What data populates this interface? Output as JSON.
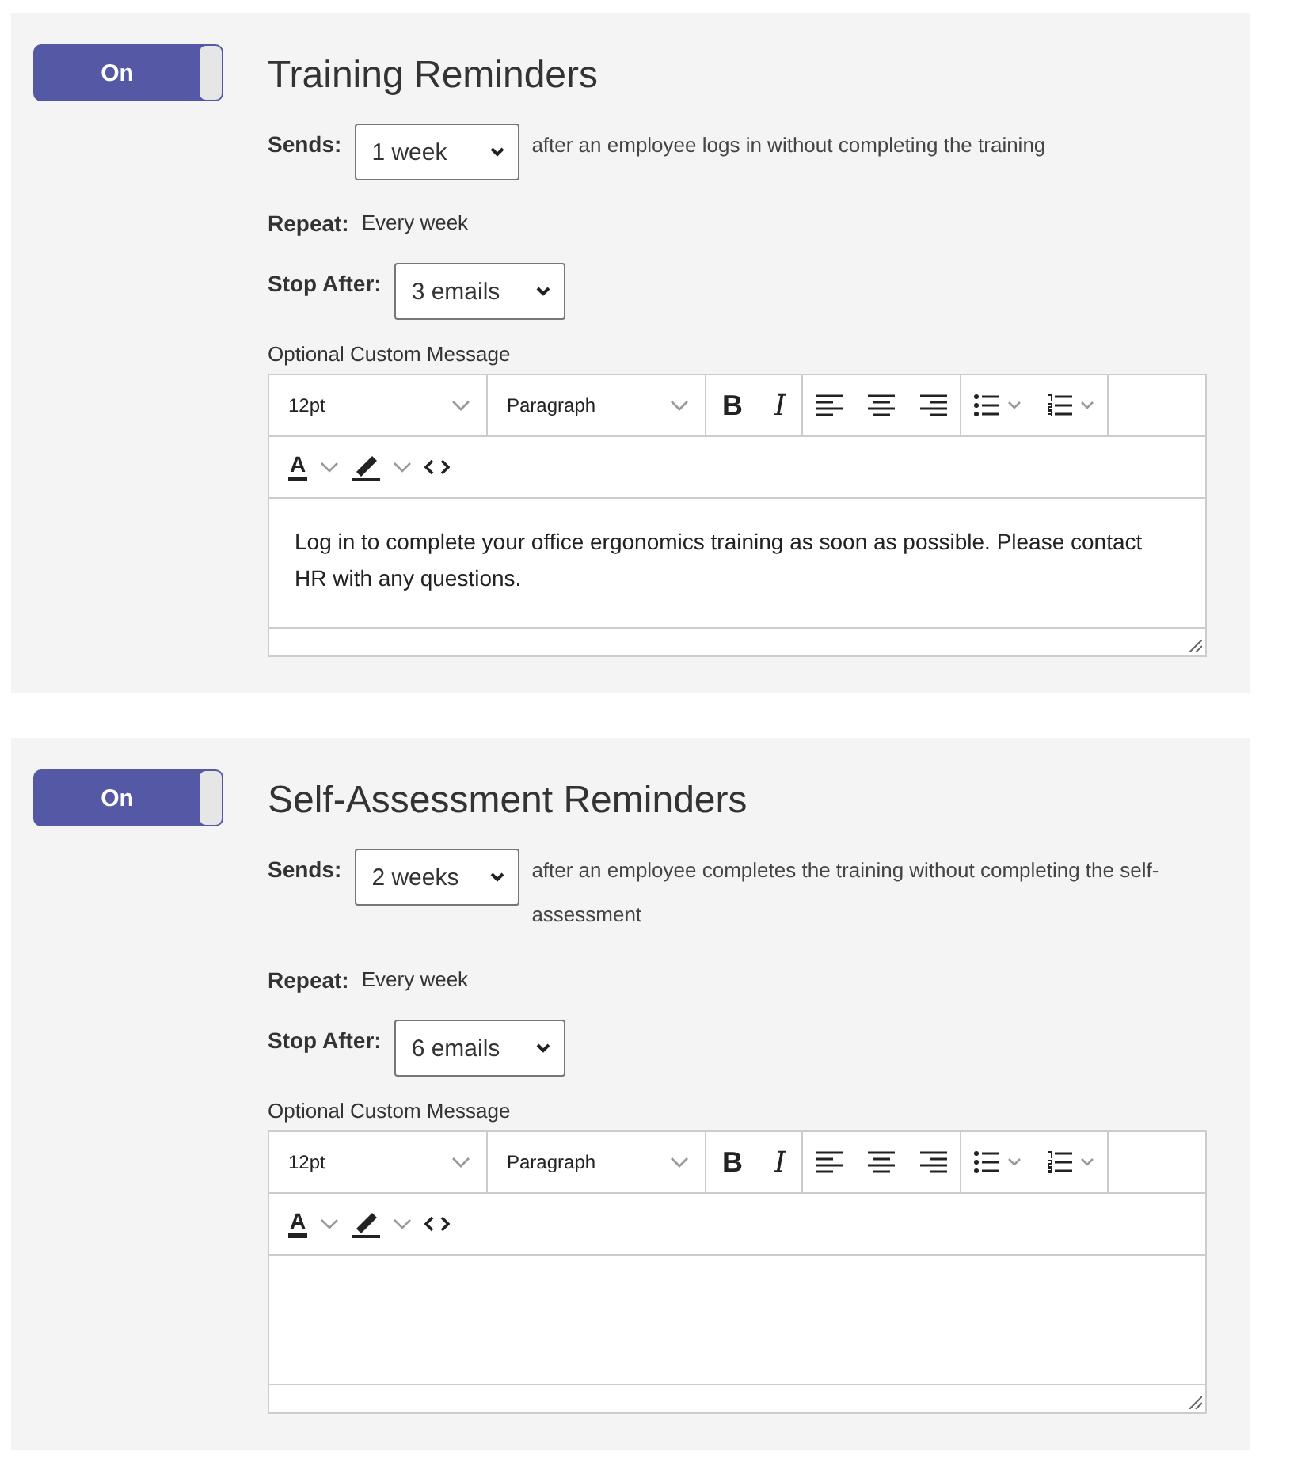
{
  "reminders": [
    {
      "on": true,
      "toggle_label": "On",
      "title": "Training Reminders",
      "sends": {
        "label": "Sends:",
        "value": "1 week",
        "description": "after an employee logs in without completing the training"
      },
      "repeat": {
        "label": "Repeat:",
        "value": "Every week"
      },
      "stop_after": {
        "label": "Stop After:",
        "value": "3 emails"
      },
      "message": {
        "label": "Optional Custom Message",
        "font_size": "12pt",
        "block_format": "Paragraph",
        "bold_glyph": "B",
        "italic_glyph": "I",
        "text_color_glyph": "A",
        "content": "Log in to complete your office ergonomics training as soon as possible. Please contact HR with any questions."
      }
    },
    {
      "on": true,
      "toggle_label": "On",
      "title": "Self-Assessment Reminders",
      "sends": {
        "label": "Sends:",
        "value": "2 weeks",
        "description": "after an employee completes the training without completing the self-assessment"
      },
      "repeat": {
        "label": "Repeat:",
        "value": "Every week"
      },
      "stop_after": {
        "label": "Stop After:",
        "value": "6 emails"
      },
      "message": {
        "label": "Optional Custom Message",
        "font_size": "12pt",
        "block_format": "Paragraph",
        "bold_glyph": "B",
        "italic_glyph": "I",
        "text_color_glyph": "A"
      }
    }
  ]
}
